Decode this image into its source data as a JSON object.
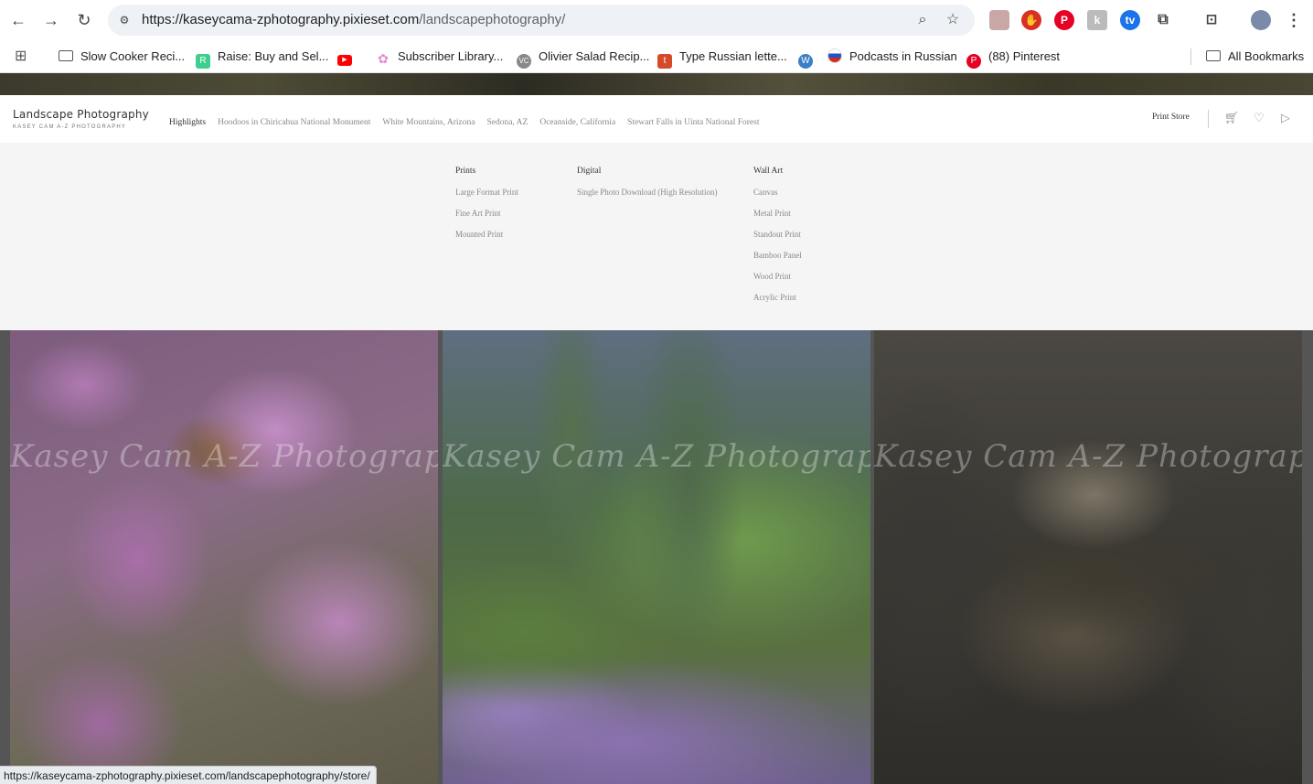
{
  "browser": {
    "url_host": "https://kaseycama-zphotography.pixieset.com",
    "url_path": "/landscapephotography/",
    "bookmarks": [
      {
        "label": "Slow Cooker Reci...",
        "icon": "folder-icon"
      },
      {
        "label": "Raise: Buy and Sel...",
        "icon": "raise-icon"
      },
      {
        "label": "",
        "icon": "youtube-icon"
      },
      {
        "label": "Subscriber Library...",
        "icon": "flower-icon"
      },
      {
        "label": "Olivier Salad Recip...",
        "icon": "vc-icon"
      },
      {
        "label": "Type Russian lette...",
        "icon": "t-icon"
      },
      {
        "label": "",
        "icon": "wordpress-icon"
      },
      {
        "label": "Podcasts in Russian",
        "icon": "russia-flag-icon"
      },
      {
        "label": "(88) Pinterest",
        "icon": "pinterest-icon"
      }
    ],
    "all_bookmarks": "All Bookmarks",
    "status_url": "https://kaseycama-zphotography.pixieset.com/landscapephotography/store/"
  },
  "site": {
    "title": "Landscape Photography",
    "subtitle": "KASEY CAM A-Z PHOTOGRAPHY",
    "nav": [
      "Highlights",
      "Hoodoos in Chiricahua National Monument",
      "White Mountains, Arizona",
      "Sedona, AZ",
      "Oceanside, California",
      "Stewart Falls in Uinta National Forest"
    ],
    "print_store": "Print Store"
  },
  "dropdown": {
    "prints": {
      "heading": "Prints",
      "items": [
        "Large Format Print",
        "Fine Art Print",
        "Mounted Print"
      ]
    },
    "digital": {
      "heading": "Digital",
      "items": [
        "Single Photo Download (High Resolution)"
      ]
    },
    "wall_art": {
      "heading": "Wall Art",
      "items": [
        "Canvas",
        "Metal Print",
        "Standout Print",
        "Bamboo Panel",
        "Wood Print",
        "Acrylic Print"
      ]
    }
  },
  "photos": {
    "watermark": "Kasey Cam A-Z Photography",
    "items": [
      {
        "subject": "wisteria-with-bee"
      },
      {
        "subject": "saguaro-cactus-with-flowers"
      },
      {
        "subject": "hummingbird-in-nest"
      }
    ]
  }
}
